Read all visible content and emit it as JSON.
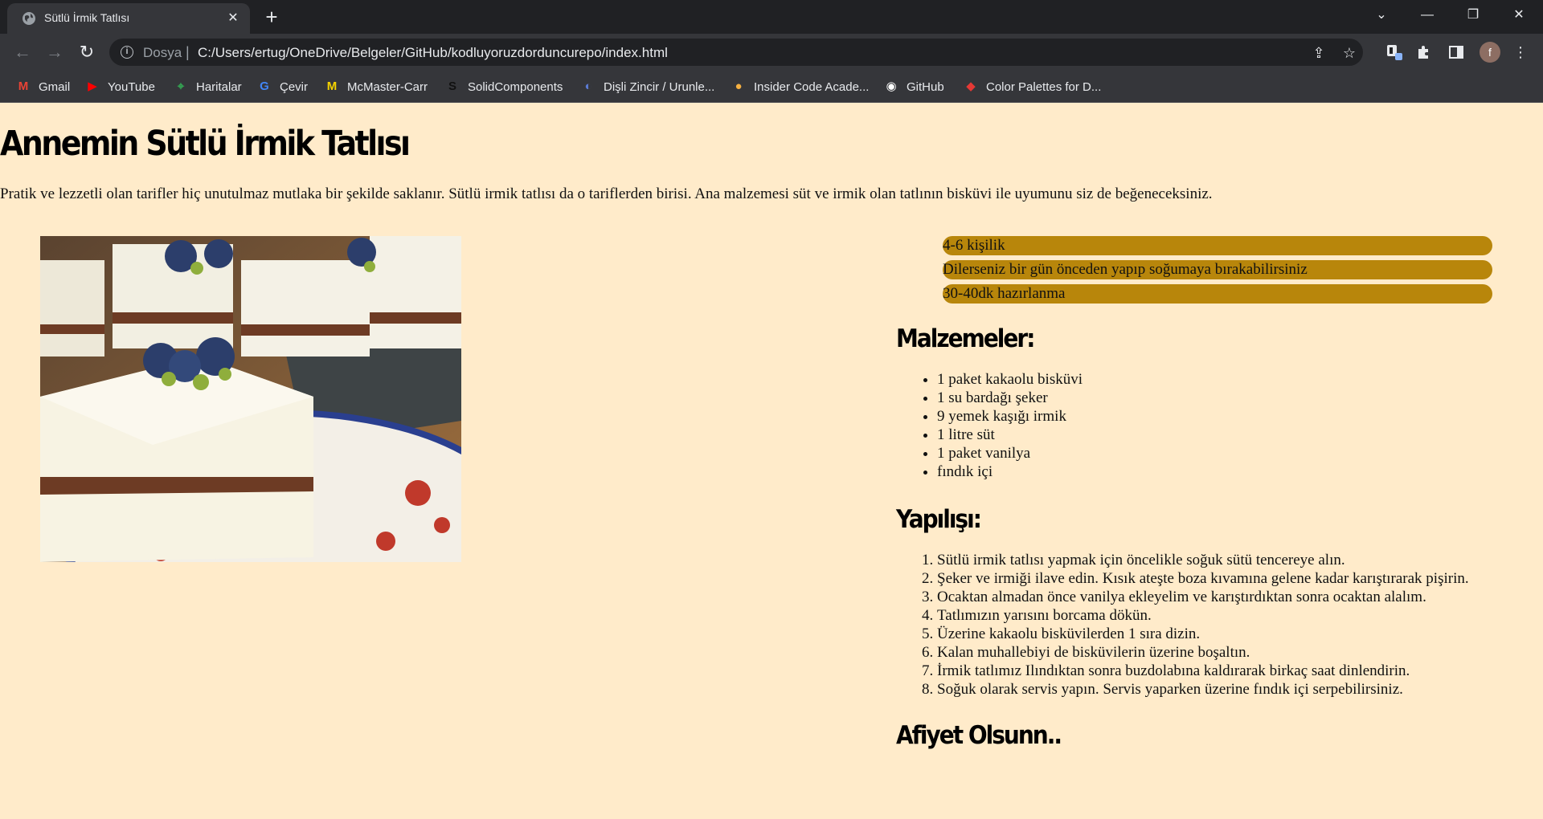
{
  "browser": {
    "tab_title": "Sütlü İrmik Tatlısı",
    "scheme_label": "Dosya",
    "url": "C:/Users/ertug/OneDrive/Belgeler/GitHub/kodluyoruzdorduncurepo/index.html",
    "profile_initial": "f",
    "bookmarks": [
      {
        "label": "Gmail",
        "icon": "gmail-icon",
        "color": "#ea4335"
      },
      {
        "label": "YouTube",
        "icon": "youtube-icon",
        "color": "#ff0000"
      },
      {
        "label": "Haritalar",
        "icon": "maps-icon",
        "color": "#34a853"
      },
      {
        "label": "Çevir",
        "icon": "translate-icon",
        "color": "#4285f4"
      },
      {
        "label": "McMaster-Carr",
        "icon": "mcmaster-icon",
        "color": "#f5d300"
      },
      {
        "label": "SolidComponents",
        "icon": "solidcomponents-icon",
        "color": "#111111"
      },
      {
        "label": "Dişli Zincir / Urunle...",
        "icon": "chain-icon",
        "color": "#5b7bd5"
      },
      {
        "label": "Insider Code Acade...",
        "icon": "insider-icon",
        "color": "#f5b041"
      },
      {
        "label": "GitHub",
        "icon": "github-icon",
        "color": "#ffffff"
      },
      {
        "label": "Color Palettes for D...",
        "icon": "palette-icon",
        "color": "#e53935"
      }
    ]
  },
  "page": {
    "title": "Annemin Sütlü İrmik Tatlısı",
    "intro": "Pratik ve lezzetli olan tarifler hiç unutulmaz mutlaka bir şekilde saklanır. Sütlü irmik tatlısı da o tariflerden birisi. Ana malzemesi süt ve irmik olan tatlının bisküvi ile uyumunu siz de beğeneceksiniz.",
    "info": [
      "4-6 kişilik",
      "Dilerseniz bir gün önceden yapıp soğumaya bırakabilirsiniz",
      "30-40dk hazırlanma"
    ],
    "info_color": "#b8860b",
    "background_color": "#ffebca",
    "ingredients_heading": "Malzemeler:",
    "ingredients": [
      "1 paket kakaolu bisküvi",
      "1 su bardağı şeker",
      "9 yemek kaşığı irmik",
      "1 litre süt",
      "1 paket vanilya",
      "fındık içi"
    ],
    "steps_heading": "Yapılışı:",
    "steps": [
      "Sütlü irmik tatlısı yapmak için öncelikle soğuk sütü tencereye alın.",
      "Şeker ve irmiği ilave edin. Kısık ateşte boza kıvamına gelene kadar karıştırarak pişirin.",
      "Ocaktan almadan önce vanilya ekleyelim ve karıştırdıktan sonra ocaktan alalım.",
      "Tatlımızın yarısını borcama dökün.",
      "Üzerine kakaolu bisküvilerden 1 sıra dizin.",
      "Kalan muhallebiyi de bisküvilerin üzerine boşaltın.",
      "İrmik tatlımız Ilındıktan sonra buzdolabına kaldırarak birkaç saat dinlendirin.",
      "Soğuk olarak servis yapın. Servis yaparken üzerine fındık içi serpebilirsiniz."
    ],
    "closing": "Afiyet Olsunn.."
  }
}
